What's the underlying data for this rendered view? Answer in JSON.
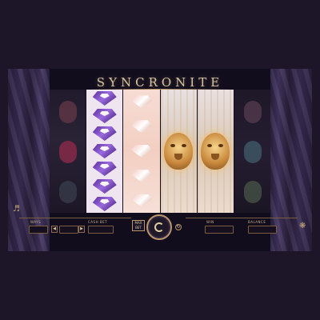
{
  "game": {
    "title": "SYNCRONITE"
  },
  "reels": {
    "reel_1_colors": [
      "#6a3a48",
      "#8c2a4a",
      "#3a4050"
    ],
    "reel_6_colors": [
      "#5a3e52",
      "#3e5a68",
      "#4a5a48"
    ]
  },
  "panel": {
    "ways_label": "WAYS",
    "ways_value": "",
    "cash_bet_label": "CASH BET",
    "cash_bet_value": "",
    "decrease_symbol": "◀",
    "increase_symbol": "▶",
    "max_bet_label": "MAX BET",
    "win_label": "WIN",
    "win_value": "",
    "balance_label": "BALANCE",
    "balance_value": ""
  },
  "icons": {
    "spin": "spin-icon",
    "autoplay": "autoplay-icon",
    "sound": "sound-icon",
    "menu": "menu-icon"
  },
  "colors": {
    "background": "#1d1629",
    "accent_gold": "#b8956a",
    "text_gold": "#d9c6a1"
  }
}
